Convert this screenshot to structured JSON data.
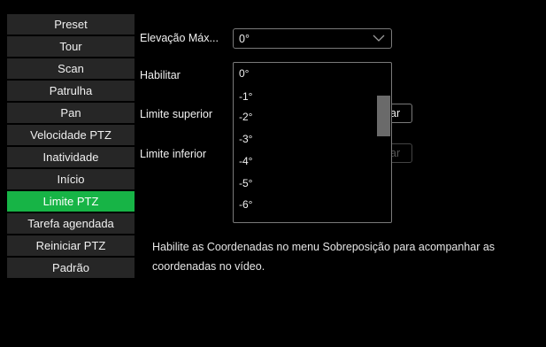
{
  "sidebar": {
    "items": [
      {
        "label": "Preset"
      },
      {
        "label": "Tour"
      },
      {
        "label": "Scan"
      },
      {
        "label": "Patrulha"
      },
      {
        "label": "Pan"
      },
      {
        "label": "Velocidade PTZ"
      },
      {
        "label": "Inatividade"
      },
      {
        "label": "Início"
      },
      {
        "label": "Limite PTZ",
        "active": true
      },
      {
        "label": "Tarefa agendada"
      },
      {
        "label": "Reiniciar PTZ"
      },
      {
        "label": "Padrão"
      }
    ]
  },
  "form": {
    "elevacao_label": "Elevação Máx...",
    "elevacao_value": "0°",
    "habilitar_label": "Habilitar",
    "limite_superior_label": "Limite superior",
    "limite_inferior_label": "Limite inferior",
    "superior_button_partial": "ar",
    "inferior_button_partial": "ar"
  },
  "dropdown": {
    "options": [
      "0°",
      "-1°",
      "-2°",
      "-3°",
      "-4°",
      "-5°",
      "-6°"
    ]
  },
  "note": "Habilite as Coordenadas no menu Sobreposição para acompanhar as\ncoordenadas no vídeo.",
  "colors": {
    "accent": "#17b446",
    "sidebar_item_bg": "#262626",
    "background": "#000000"
  }
}
